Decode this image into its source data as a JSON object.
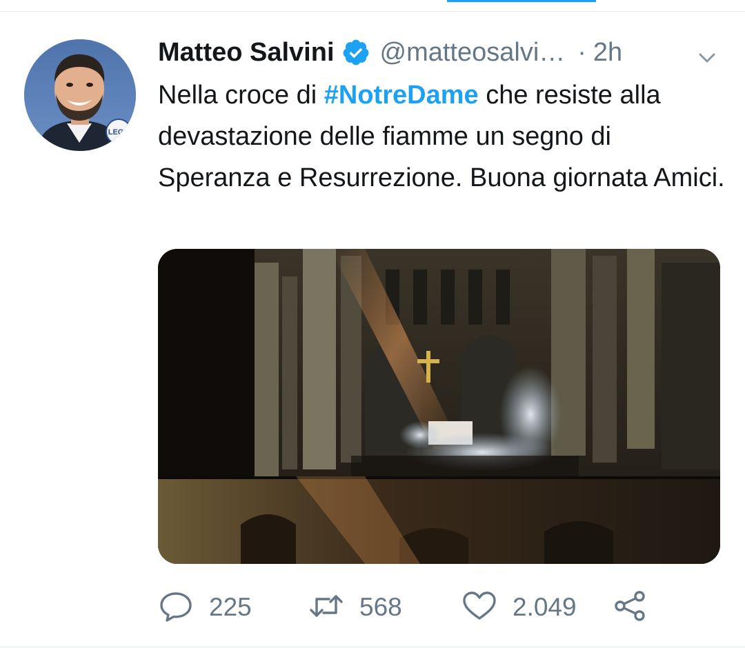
{
  "tweet": {
    "author": {
      "display_name": "Matteo Salvini",
      "handle": "@matteosalvi…",
      "verified": true,
      "avatar_badge_text": "LEGA"
    },
    "separator": "·",
    "time": "2h",
    "text": {
      "before_hashtag": "Nella croce di ",
      "hashtag": "#NotreDame",
      "after_hashtag": " che resiste alla devastazione delle fiamme un segno di Speranza e Resurrezione. Buona giornata Amici."
    },
    "media": {
      "type": "photo"
    },
    "actions": {
      "replies": "225",
      "retweets": "568",
      "likes": "2.049"
    }
  },
  "icons": {
    "verified": "verified-badge-icon",
    "more": "chevron-down-icon",
    "reply": "speech-bubble-icon",
    "retweet": "retweet-arrows-icon",
    "like": "heart-icon",
    "share": "share-nodes-icon"
  },
  "colors": {
    "accent": "#1da1f2",
    "text_primary": "#14171a",
    "text_secondary": "#657786",
    "divider": "#e6ecf0"
  }
}
